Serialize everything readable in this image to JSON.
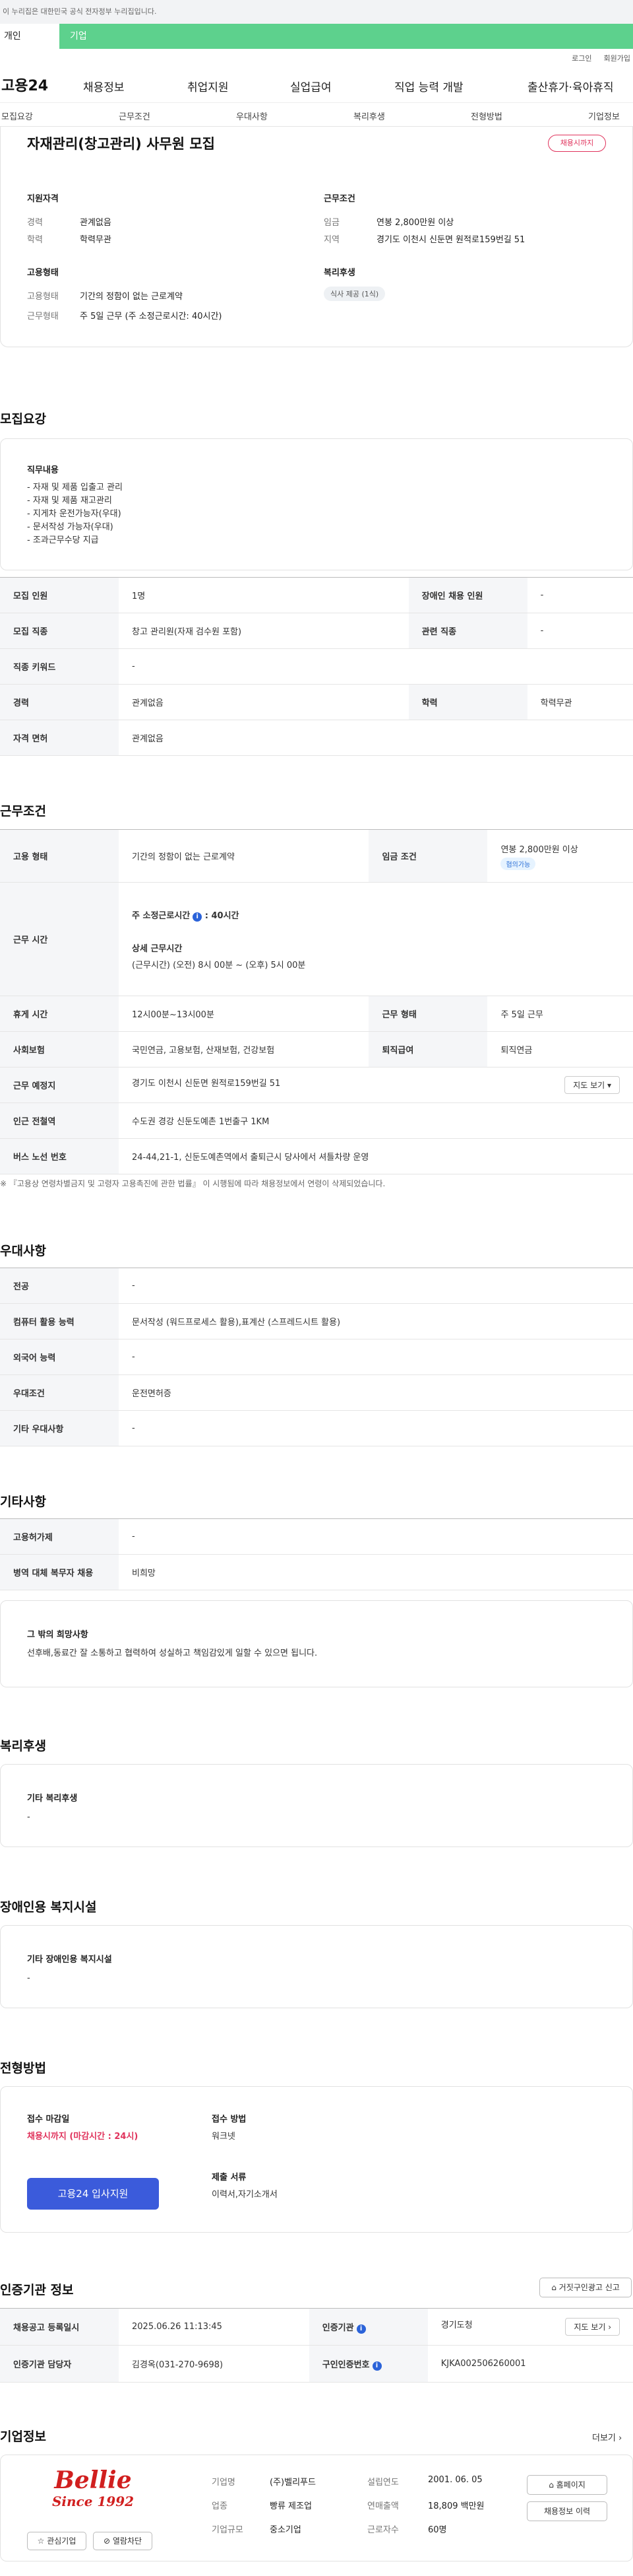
{
  "notice": "이 누리집은 대한민국 공식 전자정부 누리집입니다.",
  "usertabs": [
    "개인",
    "기업"
  ],
  "util": [
    "로그인",
    "회원가입"
  ],
  "brand": "고용24",
  "gnb": [
    "채용정보",
    "취업지원",
    "실업급여",
    "직업 능력 개발",
    "출산휴가·육아휴직"
  ],
  "subnav": [
    "모집요강",
    "근무조건",
    "우대사항",
    "복리후생",
    "전형방법",
    "기업정보"
  ],
  "summary": {
    "title": "자재관리(창고관리) 사무원 모집",
    "badge": "채용시까지",
    "qual_h": "지원자격",
    "career_k": "경력",
    "career_v": "관계없음",
    "edu_k": "학력",
    "edu_v": "학력무관",
    "cond_h": "근무조건",
    "wage_k": "임금",
    "wage_v": "연봉 2,800만원 이상",
    "loc_k": "지역",
    "loc_v": "경기도 이천시 신둔면 원적로159번길 51",
    "emp_h": "고용형태",
    "type_k": "고용형태",
    "type_v": "기간의 정함이 없는 근로계약",
    "hours_k": "근무형태",
    "hours_v": "주 5일 근무 (주 소정근로시간: 40시간)",
    "welfare_h": "복리후생",
    "welfare_v": "식사 제공 (1식)"
  },
  "recruit": {
    "heading": "모집요강",
    "duty_title": "직무내용",
    "duty_lines": [
      "- 자재 및 제품 입출고 관리",
      "- 자재 및 제품 재고관리",
      "- 지게차 운전가능자(우대)",
      "- 문서작성 가능자(우대)",
      "- 조과근무수당 지급"
    ],
    "r1": [
      "모집 인원",
      "1명",
      "장애인 채용 인원",
      "-"
    ],
    "r2": [
      "모집 직종",
      "창고 관리원(자재 검수원 포함)",
      "관련 직종",
      "-"
    ],
    "r3": [
      "직종 키워드",
      "-"
    ],
    "r4": [
      "경력",
      "관계없음",
      "학력",
      "학력무관"
    ],
    "r5": [
      "자격 면허",
      "관계없음"
    ]
  },
  "work": {
    "heading": "근무조건",
    "r1": [
      "고용 형태",
      "기간의 정함이 없는 근로계약",
      "임금 조건",
      "연봉 2,800만원 이상",
      "협의가능"
    ],
    "hours_k": "근무 시간",
    "hours_l1": "주 소정근로시간",
    "hours_l1v": ": 40시간",
    "hours_l2": "상세 근무시간",
    "hours_l3": "(근무시간) (오전) 8시 00분 ~ (오후) 5시 00분",
    "r3": [
      "휴게 시간",
      "12시00분~13시00분",
      "근무 형태",
      "주 5일 근무"
    ],
    "r4": [
      "사회보험",
      "국민연금, 고용보험, 산재보험, 건강보험",
      "퇴직급여",
      "퇴직연금"
    ],
    "r5": [
      "근무 예정지",
      "경기도 이천시 신둔면 원적로159번길 51",
      "지도 보기"
    ],
    "r6": [
      "인근 전철역",
      "수도권 경강 신둔도예촌 1번출구 1KM"
    ],
    "r7": [
      "버스 노선 번호",
      "24-44,21-1, 신둔도예촌역에서 출퇴근시 당사에서 셔틀차량 운영"
    ],
    "note": "※ 『고용상 연령차별금지 및 고령자 고용촉진에 관한 법률』 이 시행됨에 따라 채용정보에서 연령이 삭제되었습니다."
  },
  "pref": {
    "heading": "우대사항",
    "rows": [
      [
        "전공",
        "-"
      ],
      [
        "컴퓨터 활용 능력",
        "문서작성 (워드프로세스 활용),표계산 (스프레드시트 활용)"
      ],
      [
        "외국어 능력",
        "-"
      ],
      [
        "우대조건",
        "운전면허증"
      ],
      [
        "기타 우대사항",
        "-"
      ]
    ]
  },
  "etc": {
    "heading": "기타사항",
    "rows": [
      [
        "고용허가제",
        "-"
      ],
      [
        "병역 대체 복무자 채용",
        "비희망"
      ]
    ],
    "box_title": "그 밖의 희망사항",
    "box_text": "선후배,동료간 잘 소통하고 협력하여 성실하고 책임감있게 일할 수 있으면 됩니다."
  },
  "welfare": {
    "heading": "복리후생",
    "title": "기타 복리후생",
    "text": "-"
  },
  "disab": {
    "heading": "장애인용 복지시설",
    "title": "기타 장애인용 복지시설",
    "text": "-"
  },
  "process": {
    "heading": "전형방법",
    "close_k": "접수 마감일",
    "close_v": "채용시까지 (마감시간 : 24시)",
    "method_k": "접수 방법",
    "method_v": "워크넷",
    "docs_k": "제출 서류",
    "docs_v": "이력서,자기소개서",
    "apply": "고용24 입사지원"
  },
  "cert": {
    "heading": "인증기관 정보",
    "report": "거짓구인광고 신고",
    "r1": [
      "채용공고 등록일시",
      "2025.06.26 11:13:45",
      "인증기관",
      "경기도청",
      "지도 보기"
    ],
    "r2": [
      "인증기관 담당자",
      "김경옥(031-270-9698)",
      "구인인증번호",
      "KJKA002506260001"
    ]
  },
  "company": {
    "heading": "기업정보",
    "more": "더보기",
    "logo_top": "Bellie",
    "logo_bottom": "Since 1992",
    "interest": "관심기업",
    "block": "열람차단",
    "name_k": "기업명",
    "name_v": "(주)벨리푸드",
    "found_k": "설립연도",
    "found_v": "2001. 06. 05",
    "ind_k": "업종",
    "ind_v": "빵류 제조업",
    "sales_k": "연매출액",
    "sales_v": "18,809 백만원",
    "size_k": "기업규모",
    "size_v": "중소기업",
    "staff_k": "근로자수",
    "staff_v": "60명",
    "home": "홈페이지",
    "history": "채용정보 이력"
  },
  "colors": {
    "green": "#5dd18d",
    "accent": "#3b5bdb",
    "danger": "#e0335c"
  }
}
